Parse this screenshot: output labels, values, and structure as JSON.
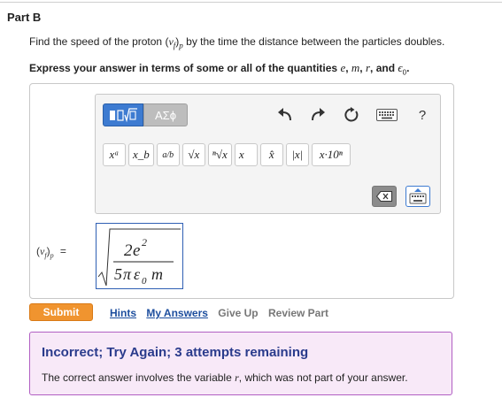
{
  "part": {
    "title": "Part B"
  },
  "question": {
    "prefix": "Find the speed of the proton",
    "suffix": "by the time the distance between the particles doubles.",
    "var_v": "v",
    "var_f": "f",
    "var_p": "p"
  },
  "instruction": {
    "text": "Express your answer in terms of some or all of the quantities",
    "q1": "e",
    "q2": "m",
    "q3": "r",
    "q4": "ϵ",
    "q4_sub": "0",
    "sep": ",",
    "and": "and",
    "period": "."
  },
  "toolbar": {
    "templates_icon": "templates-icon",
    "greek_label": "ΑΣϕ",
    "help_label": "?",
    "symbols": [
      "xᵃ",
      "x_b",
      "a/b",
      "√x",
      "ⁿ√x",
      "x⃗",
      "x̂",
      "|x|",
      "x·10ⁿ"
    ]
  },
  "answer": {
    "label_v": "v",
    "label_f": "f",
    "label_p": "p",
    "equals": "=",
    "num_coef": "2",
    "num_var": "e",
    "num_exp": "2",
    "den_coef": "5",
    "den_pi": "π",
    "den_eps": "ε",
    "den_sub": "0",
    "den_m": "m"
  },
  "actions": {
    "submit_label": "Submit",
    "hints_label": "Hints",
    "my_answers_label": "My Answers",
    "give_up_label": "Give Up",
    "review_part_label": "Review Part"
  },
  "feedback": {
    "title": "Incorrect; Try Again; 3 attempts remaining",
    "text_prefix": "The correct answer involves the variable",
    "text_var": "r",
    "text_suffix": ", which was not part of your answer."
  },
  "colors": {
    "accent_blue": "#3d7bd1",
    "submit_orange": "#f0942f",
    "feedback_border": "#b15fc3",
    "feedback_bg": "#f8e9f8",
    "feedback_title": "#2a3b8c"
  }
}
